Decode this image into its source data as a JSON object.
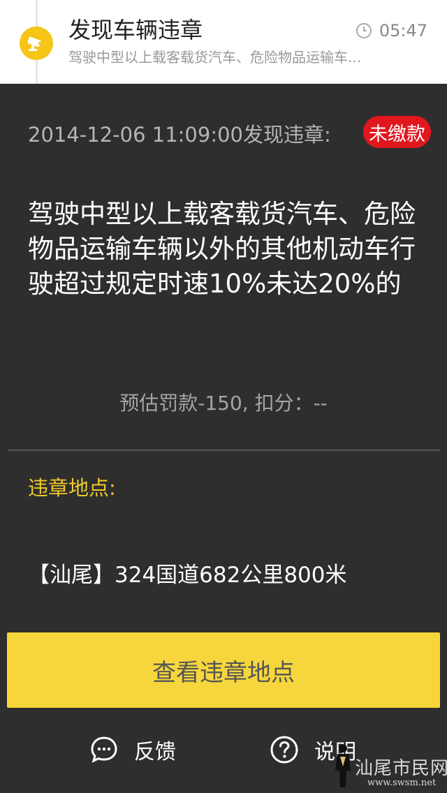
{
  "notification": {
    "icon": "camera-icon",
    "title": "发现车辆违章",
    "subtitle": "驾驶中型以上载客载货汽车、危险物品运输车...",
    "time": "05:47",
    "colors": {
      "icon_bg": "#f5c518"
    }
  },
  "violation": {
    "detected_text": "2014-12-06 11:09:00发现违章:",
    "status_badge": "未缴款",
    "description": "驾驶中型以上载客载货汽车、危险物品运输车辆以外的其他机动车行驶超过规定时速10%未达20%的",
    "fine_text": "预估罚款-150, 扣分：--",
    "location_label": "违章地点:",
    "location_value": "【汕尾】324国道682公里800米"
  },
  "actions": {
    "view_location_label": "查看违章地点",
    "feedback_label": "反馈",
    "explain_label": "说明"
  },
  "watermark": {
    "text": "汕尾市民网",
    "url": "www.swsm.net"
  },
  "colors": {
    "background": "#2e2e2e",
    "accent_yellow": "#f6d63c",
    "badge_red": "#e1161e",
    "location_label": "#f0c92a"
  }
}
